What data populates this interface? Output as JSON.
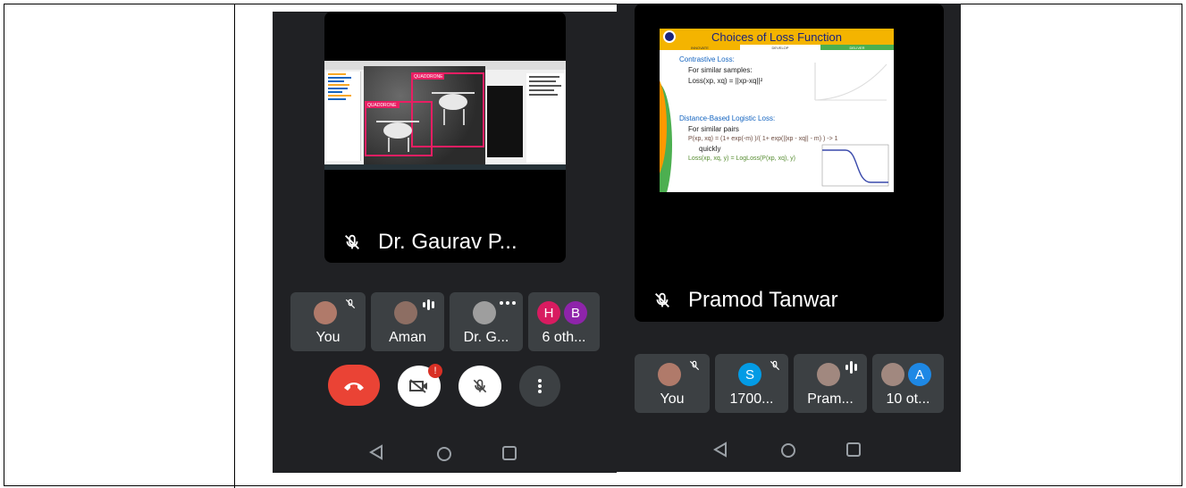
{
  "left_phone": {
    "speaker_name": "Dr. Gaurav P...",
    "shared_labels": [
      "QUADDRONE",
      "QUADDRONE"
    ],
    "participants": [
      {
        "label": "You"
      },
      {
        "label": "Aman"
      },
      {
        "label": "Dr. G..."
      },
      {
        "label": "6 oth...",
        "initials": [
          "H",
          "B"
        ]
      }
    ],
    "badge": "!"
  },
  "right_phone": {
    "speaker_name": "Pramod Tanwar",
    "slide": {
      "title": "Choices of Loss Function",
      "header_tabs": [
        "INNOVATE",
        "DEVELOP",
        "DELIVER"
      ],
      "bullet1": "Contrastive Loss:",
      "line1": "For similar samples:",
      "formula1": "Loss(xp, xq) = ||xp-xq||²",
      "bullet2": "Distance-Based Logistic Loss:",
      "line2": "For similar pairs",
      "formula2": "P(xp, xq) = (1+ exp(-m) )/( 1+ exp(||xp - xq|| - m) ) -> 1",
      "formula2b": "quickly",
      "formula3": "Loss(xp, xq, y) = LogLoss(P(xp, xq), y)"
    },
    "participants": [
      {
        "label": "You"
      },
      {
        "label": "1700...",
        "initials": [
          "S"
        ]
      },
      {
        "label": "Pram..."
      },
      {
        "label": "10 ot...",
        "initials": [
          "A"
        ]
      }
    ]
  },
  "colors": {
    "end_call": "#ea4335",
    "avatar_h": "#d81b60",
    "avatar_b": "#8e24aa",
    "avatar_s": "#039be5",
    "avatar_a": "#1e88e5",
    "bbox": "#e91e63"
  }
}
